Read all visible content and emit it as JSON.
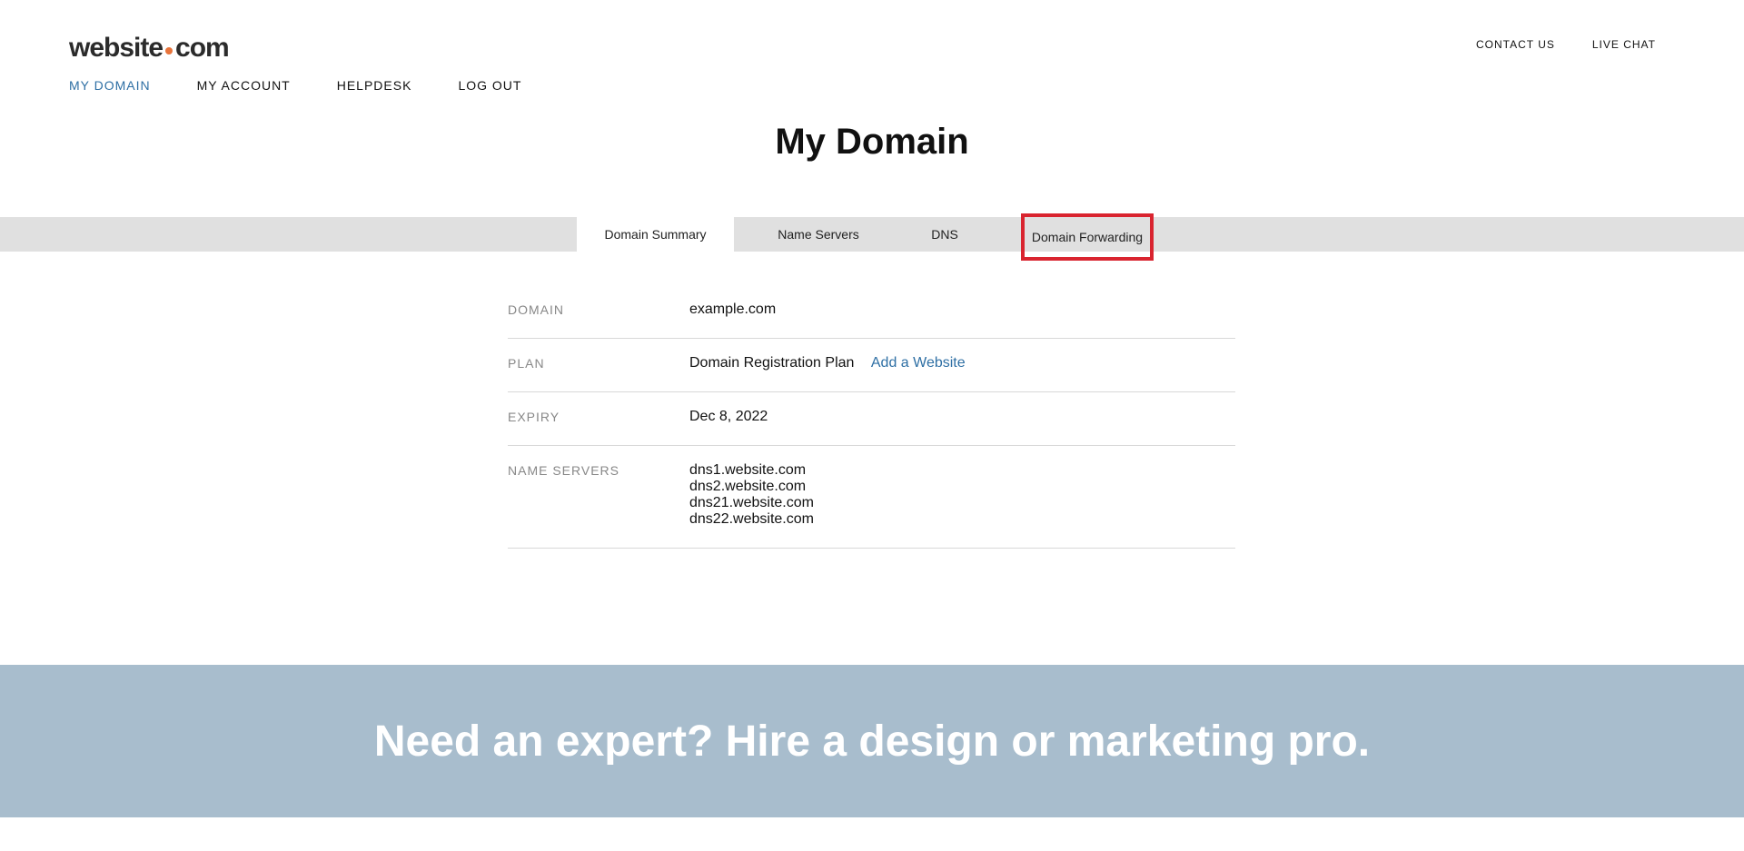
{
  "logo": {
    "left": "website",
    "right": "com"
  },
  "main_nav": [
    "MY DOMAIN",
    "MY ACCOUNT",
    "HELPDESK",
    "LOG OUT"
  ],
  "util_nav": [
    "CONTACT US",
    "LIVE CHAT"
  ],
  "page_title": "My Domain",
  "tabs": [
    "Domain Summary",
    "Name Servers",
    "DNS",
    "Domain Forwarding"
  ],
  "summary": {
    "domain_label": "DOMAIN",
    "domain_value": "example.com",
    "plan_label": "PLAN",
    "plan_value": "Domain Registration Plan",
    "plan_link": "Add a Website",
    "expiry_label": "EXPIRY",
    "expiry_value": "Dec 8, 2022",
    "ns_label": "NAME SERVERS",
    "ns_values": [
      "dns1.website.com",
      "dns2.website.com",
      "dns21.website.com",
      "dns22.website.com"
    ]
  },
  "banner_text": "Need an expert? Hire a design or marketing pro.",
  "colors": {
    "accent": "#2e6fa4",
    "highlight": "#d9242f",
    "banner": "#a8bdcd",
    "logo_dot": "#e8743b"
  }
}
